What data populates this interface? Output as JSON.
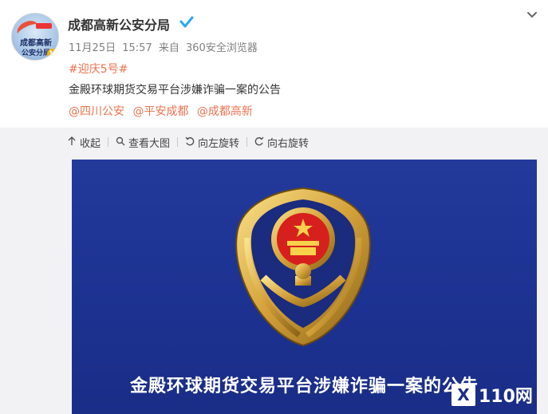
{
  "post": {
    "author": "成都高新公安分局",
    "avatar_text_line1": "成都高新",
    "avatar_text_line2": "公安分局",
    "meta": {
      "date": "11月25日",
      "time": "15:57",
      "source_prefix": "来自",
      "source": "360安全浏览器"
    },
    "hashtag": "#迎庆5号#",
    "title": "金殿环球期货交易平台涉嫌诈骗一案的公告",
    "mentions": [
      "@四川公安",
      "@平安成都",
      "@成都高新"
    ]
  },
  "toolbar": {
    "collapse_label": "收起",
    "view_large_label": "查看大图",
    "rotate_left_label": "向左旋转",
    "rotate_right_label": "向右旋转"
  },
  "image": {
    "caption": "金殿环球期货交易平台涉嫌诈骗一案的公告",
    "background_color": "#1e3490"
  },
  "watermark": {
    "box_text": "X",
    "text": "110网"
  },
  "colors": {
    "link": "#eb7350",
    "verified": "#2aa8f2",
    "meta": "#808080"
  }
}
